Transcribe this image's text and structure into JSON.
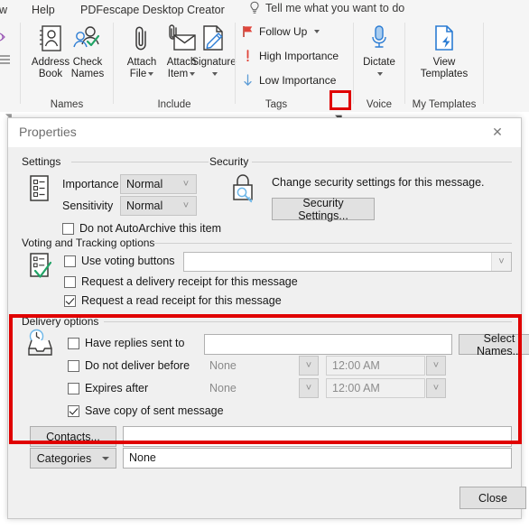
{
  "menu": {
    "partial_tab": "w",
    "items": [
      "Help",
      "PDFescape Desktop Creator"
    ],
    "tell_me": "Tell me what you want to do",
    "tell_me_icon": "lightbulb-icon"
  },
  "ribbon": {
    "groups": [
      {
        "name": "Names",
        "label": "Names",
        "buttons": [
          {
            "label_line1": "Address",
            "label_line2": "Book",
            "icon": "address-book-icon",
            "has_caret": false
          },
          {
            "label_line1": "Check",
            "label_line2": "Names",
            "icon": "check-names-icon",
            "has_caret": false
          }
        ]
      },
      {
        "name": "Include",
        "label": "Include",
        "buttons": [
          {
            "label_line1": "Attach",
            "label_line2": "File",
            "icon": "paperclip-icon",
            "has_caret": true
          },
          {
            "label_line1": "Attach",
            "label_line2": "Item",
            "icon": "attach-item-icon",
            "has_caret": true
          },
          {
            "label_line1": "Signature",
            "label_line2": "",
            "icon": "signature-icon",
            "has_caret": true
          }
        ]
      },
      {
        "name": "Tags",
        "label": "Tags",
        "rows": [
          {
            "label": "Follow Up",
            "icon": "flag-icon",
            "has_caret": true
          },
          {
            "label": "High Importance",
            "icon": "exclamation-icon",
            "has_caret": false
          },
          {
            "label": "Low Importance",
            "icon": "down-arrow-icon",
            "has_caret": false
          }
        ],
        "dialog_launcher": "dialog-box-launcher-icon",
        "launcher_highlighted": true
      },
      {
        "name": "Voice",
        "label": "Voice",
        "buttons": [
          {
            "label_line1": "Dictate",
            "label_line2": "",
            "icon": "microphone-icon",
            "has_caret": true
          }
        ]
      },
      {
        "name": "My Templates",
        "label": "My Templates",
        "buttons": [
          {
            "label_line1": "View",
            "label_line2": "Templates",
            "icon": "view-templates-icon",
            "has_caret": false
          }
        ]
      }
    ]
  },
  "dialog": {
    "title": "Properties",
    "close_icon": "close-icon",
    "settings": {
      "title": "Settings",
      "icon": "settings-list-icon",
      "importance_label": "Importance",
      "importance_value": "Normal",
      "sensitivity_label": "Sensitivity",
      "sensitivity_value": "Normal",
      "no_autoarchive_label": "Do not AutoArchive this item",
      "no_autoarchive_checked": false
    },
    "security": {
      "title": "Security",
      "icon": "lock-key-icon",
      "description": "Change security settings for this message.",
      "button_label": "Security Settings..."
    },
    "voting": {
      "title": "Voting and Tracking options",
      "icon": "voting-checklist-icon",
      "use_voting_label": "Use voting buttons",
      "use_voting_checked": false,
      "voting_buttons_value": "",
      "delivery_receipt_label": "Request a delivery receipt for this message",
      "delivery_receipt_checked": false,
      "read_receipt_label": "Request a read receipt for this message",
      "read_receipt_checked": true
    },
    "delivery": {
      "title": "Delivery options",
      "icon": "delivery-tray-clock-icon",
      "highlighted": true,
      "have_replies_label": "Have replies sent to",
      "have_replies_checked": false,
      "have_replies_value": "",
      "select_names_label": "Select Names...",
      "do_not_deliver_label": "Do not deliver before",
      "do_not_deliver_checked": false,
      "do_not_deliver_date": "None",
      "do_not_deliver_time": "12:00 AM",
      "expires_after_label": "Expires after",
      "expires_after_checked": false,
      "expires_after_date": "None",
      "expires_after_time": "12:00 AM",
      "save_copy_label": "Save copy of sent message",
      "save_copy_checked": true,
      "contacts_label": "Contacts...",
      "contacts_value": ""
    },
    "categories": {
      "label": "Categories",
      "value": "None"
    },
    "close_button_label": "Close"
  },
  "colors": {
    "highlight_red": "#e00000",
    "accent_blue": "#2b7cd3",
    "flag_red": "#e0443a",
    "check_green": "#21a366",
    "dialog_bg": "#f0f0f0",
    "ribbon_bg": "#f5f5f5"
  }
}
